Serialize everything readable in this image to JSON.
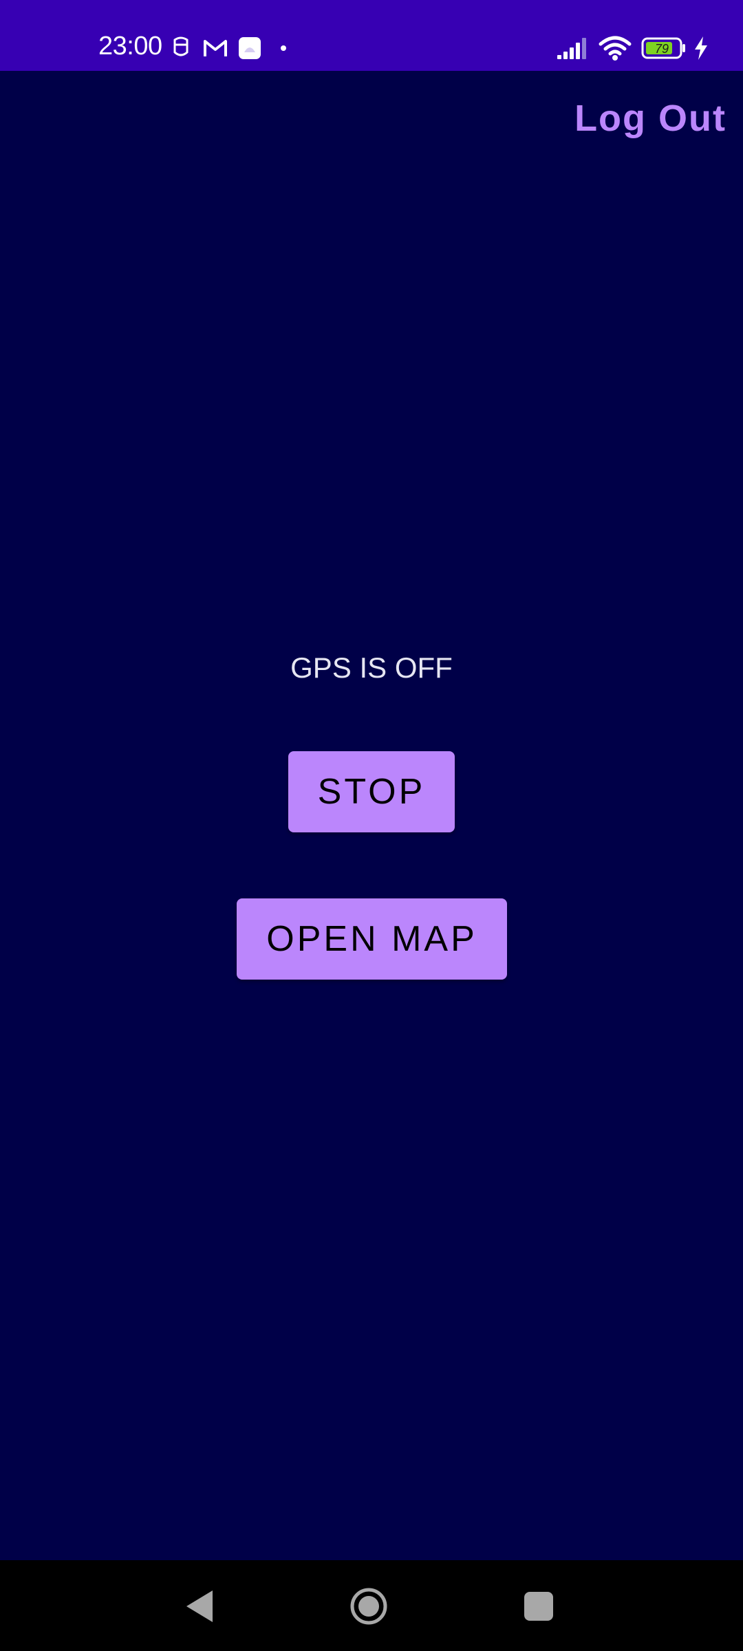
{
  "status_bar": {
    "time": "23:00",
    "battery_level": "79",
    "icons": [
      "notification-app-icon",
      "gmail-icon",
      "app-notification-icon",
      "dot-icon",
      "signal-icon",
      "wifi-icon",
      "battery-icon",
      "charging-icon"
    ]
  },
  "header": {
    "logout_label": "Log Out"
  },
  "main": {
    "gps_status": "GPS IS OFF",
    "stop_label": "STOP",
    "open_map_label": "OPEN MAP"
  },
  "nav_bar": {
    "icons": [
      "back-icon",
      "home-icon",
      "recents-icon"
    ]
  },
  "colors": {
    "status_bar": "#3700b3",
    "background": "#000048",
    "accent": "#bb86fc",
    "battery_fill": "#7ed321"
  }
}
